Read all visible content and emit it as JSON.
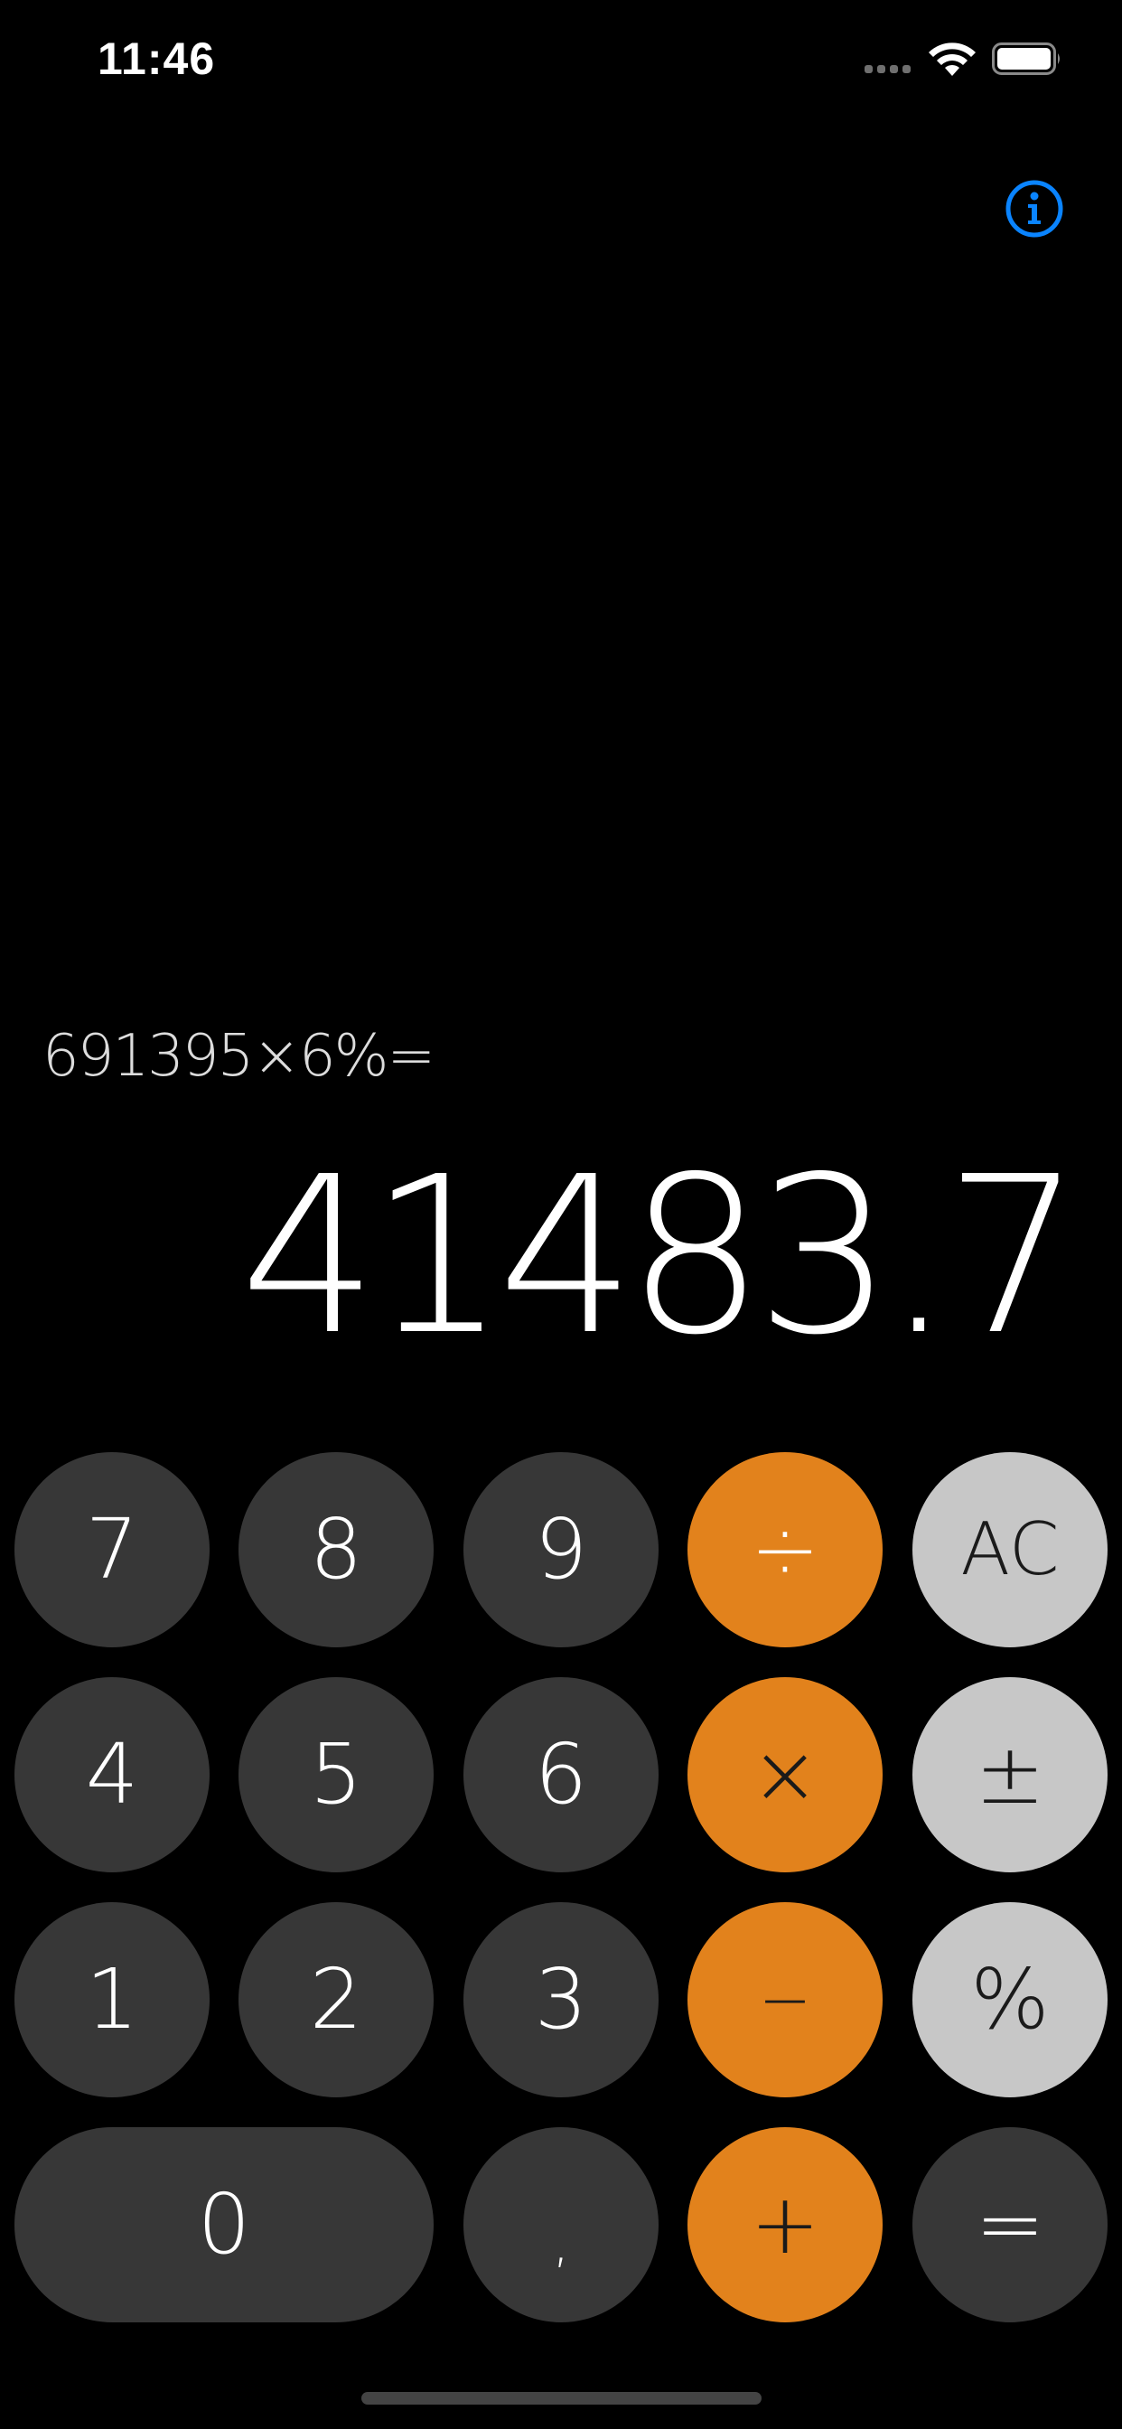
{
  "status_bar": {
    "time": "11:46"
  },
  "display": {
    "expression": "691395×6%=",
    "result": "41483.7"
  },
  "keypad": {
    "row1": [
      "7",
      "8",
      "9",
      "÷",
      "AC"
    ],
    "row2": [
      "4",
      "5",
      "6",
      "×",
      "±"
    ],
    "row3": [
      "1",
      "2",
      "3",
      "−",
      "%"
    ],
    "row4": [
      "0",
      ",",
      "+",
      "="
    ]
  },
  "colors": {
    "background": "#000000",
    "number_key": "#373737",
    "operator_key": "#e2821c",
    "function_key": "#c7c7c7",
    "accent_info": "#0a84ff"
  },
  "icons": {
    "info": "info-circle-icon",
    "wifi": "wifi-icon",
    "battery": "battery-icon",
    "signal": "cellular-signal-icon"
  }
}
